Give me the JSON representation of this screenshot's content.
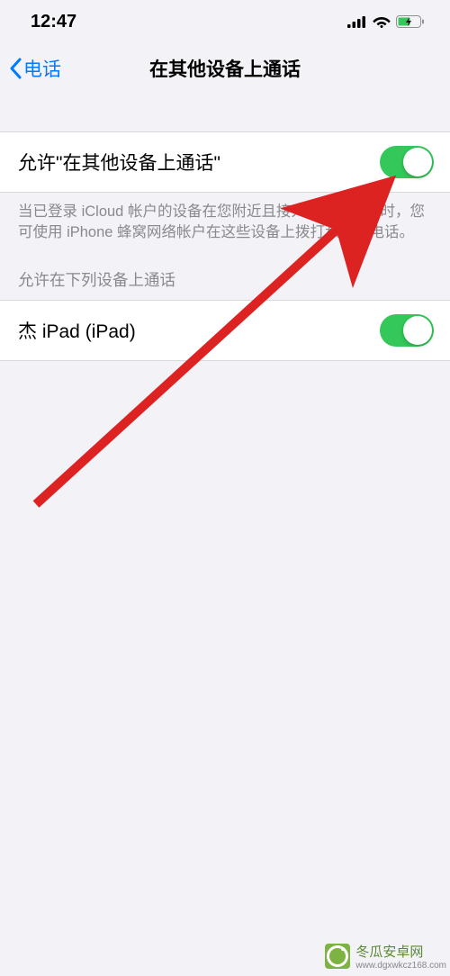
{
  "status_bar": {
    "time": "12:47"
  },
  "nav": {
    "back_label": "电话",
    "title": "在其他设备上通话"
  },
  "main_toggle": {
    "label": "允许\"在其他设备上通话\"",
    "description": "当已登录 iCloud 帐户的设备在您附近且接入无线局域网时，您可使用 iPhone 蜂窝网络帐户在这些设备上拨打和接听电话。"
  },
  "devices_section": {
    "header": "允许在下列设备上通话",
    "items": [
      {
        "label": "杰 iPad (iPad)"
      }
    ]
  },
  "watermark": {
    "text": "冬瓜安卓网",
    "url": "www.dgxwkcz168.com"
  }
}
